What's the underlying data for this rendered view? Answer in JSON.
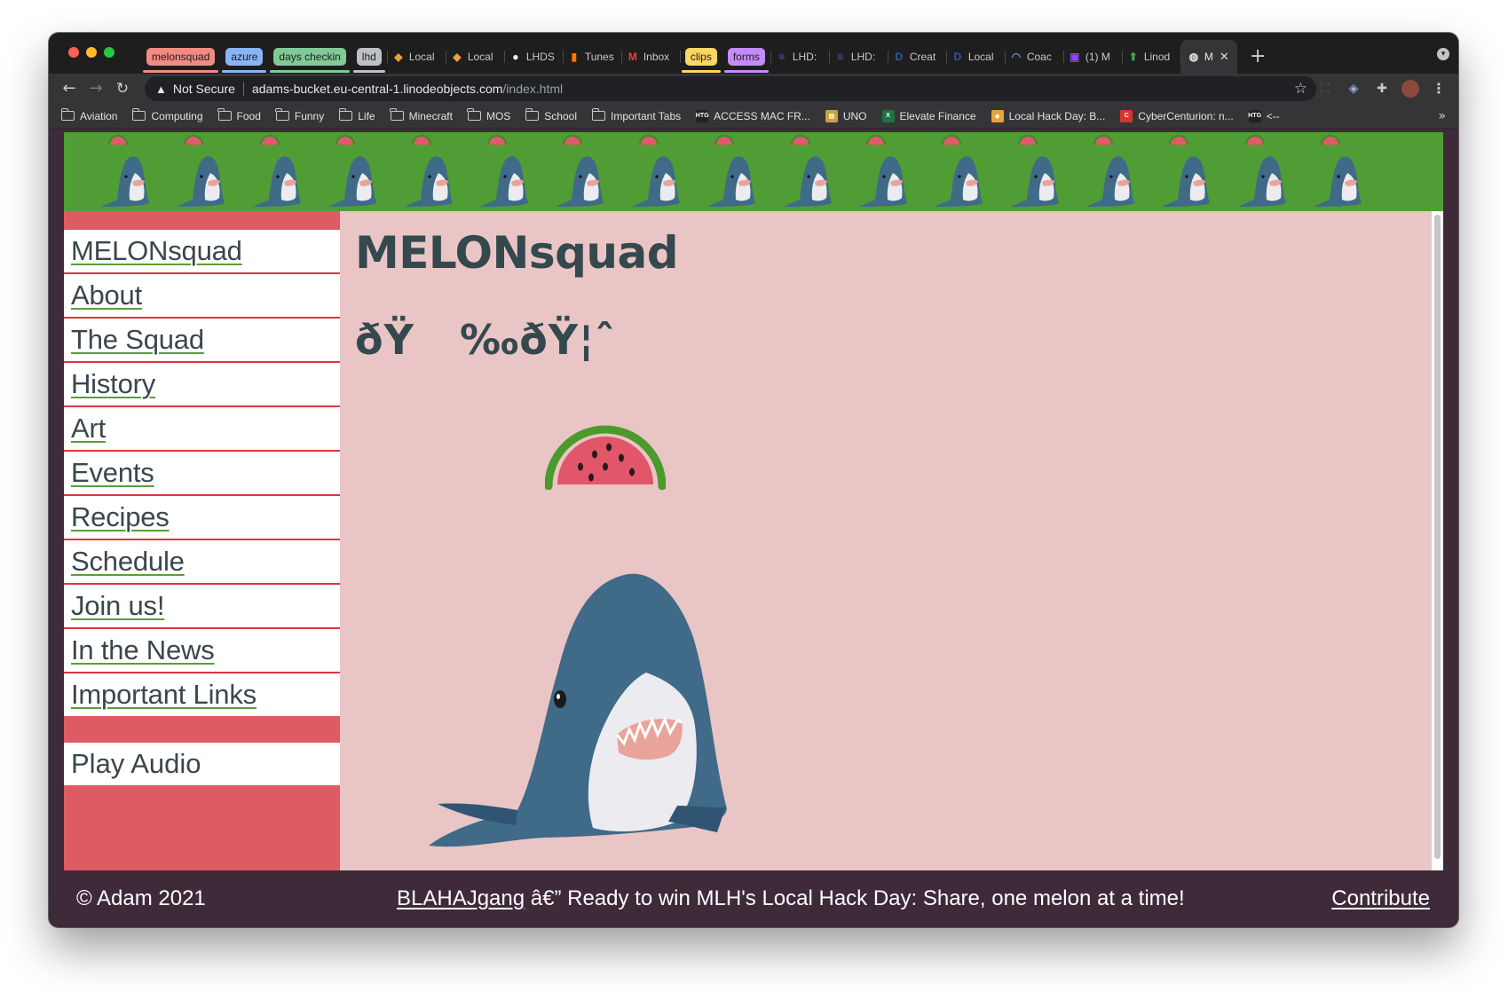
{
  "browser": {
    "tabs": [
      {
        "kind": "group",
        "label": "melonsquad",
        "color": "#f28b82"
      },
      {
        "kind": "group",
        "label": "azure",
        "color": "#8ab4f8"
      },
      {
        "kind": "group",
        "label": "days checkin",
        "color": "#81c995"
      },
      {
        "kind": "group",
        "label": "lhd",
        "color": "#bdc1c6"
      },
      {
        "kind": "tab",
        "title": "Local",
        "icon": "devpost-icon",
        "icon_color": "#e8a33a"
      },
      {
        "kind": "tab",
        "title": "Local",
        "icon": "devpost-icon",
        "icon_color": "#e8a33a"
      },
      {
        "kind": "tab",
        "title": "LHDS",
        "icon": "github-icon",
        "icon_color": "#ffffff"
      },
      {
        "kind": "tab",
        "title": "Tunes",
        "icon": "soundcloud-icon",
        "icon_color": "#ff7700"
      },
      {
        "kind": "tab",
        "title": "Inbox",
        "icon": "gmail-icon",
        "icon_color": "#ea4335"
      },
      {
        "kind": "group",
        "label": "clips",
        "color": "#fdd663"
      },
      {
        "kind": "group",
        "label": "forms",
        "color": "#c58af9"
      },
      {
        "kind": "tab",
        "title": "LHD:",
        "icon": "forms-icon",
        "icon_color": "#7248b9"
      },
      {
        "kind": "tab",
        "title": "LHD:",
        "icon": "forms-icon",
        "icon_color": "#7248b9"
      },
      {
        "kind": "tab",
        "title": "Creat",
        "icon": "d-icon",
        "icon_color": "#2e5aa8"
      },
      {
        "kind": "tab",
        "title": "Local",
        "icon": "d-icon",
        "icon_color": "#2e5aa8"
      },
      {
        "kind": "tab",
        "title": "Coac",
        "icon": "coach-icon",
        "icon_color": "#6a8fd0"
      },
      {
        "kind": "tab",
        "title": "(1) M",
        "icon": "twitch-icon",
        "icon_color": "#9146ff"
      },
      {
        "kind": "tab",
        "title": "Linod",
        "icon": "linode-icon",
        "icon_color": "#3aa655"
      },
      {
        "kind": "active",
        "title": "M",
        "icon": "globe-icon",
        "icon_color": "#e8e8e8"
      }
    ],
    "new_tab_glyph": "+",
    "close_glyph": "✕",
    "security_label": "Not Secure",
    "url_host": "adams-bucket.eu-central-1.linodeobjects.com",
    "url_path": "/index.html",
    "bookmarks": [
      {
        "label": "Aviation",
        "icon": "folder-icon"
      },
      {
        "label": "Computing",
        "icon": "folder-icon"
      },
      {
        "label": "Food",
        "icon": "folder-icon"
      },
      {
        "label": "Funny",
        "icon": "folder-icon"
      },
      {
        "label": "Life",
        "icon": "folder-icon"
      },
      {
        "label": "Minecraft",
        "icon": "folder-icon"
      },
      {
        "label": "MOS",
        "icon": "folder-icon"
      },
      {
        "label": "School",
        "icon": "folder-icon"
      },
      {
        "label": "Important Tabs",
        "icon": "folder-icon"
      },
      {
        "label": "ACCESS MAC FR...",
        "icon": "htg-icon",
        "icon_color": "#222222"
      },
      {
        "label": "UNO",
        "icon": "uno-icon",
        "icon_color": "#c8a040"
      },
      {
        "label": "Elevate Finance",
        "icon": "excel-icon",
        "icon_color": "#1e7145"
      },
      {
        "label": "Local Hack Day: B...",
        "icon": "devpost-icon",
        "icon_color": "#e8a33a"
      },
      {
        "label": "CyberCenturion: n...",
        "icon": "cybercenturion-icon",
        "icon_color": "#d8352b"
      },
      {
        "label": "<--",
        "icon": "htg-icon",
        "icon_color": "#222222"
      }
    ],
    "bookmarks_overflow": "»"
  },
  "page": {
    "nav": [
      "MELONsquad",
      "About",
      "The Squad",
      "History",
      "Art",
      "Events",
      "Recipes",
      "Schedule",
      "Join us!",
      "In the News",
      "Important Links"
    ],
    "play_audio": "Play Audio",
    "title": "MELONsquad",
    "mojibake_line": "ðŸ   ‰ðŸ¦ˆ",
    "footer": {
      "copyright": "© Adam 2021",
      "tagline_link": "BLAHAJgang",
      "tagline_rest": " â€” Ready to win MLH's Local Hack Day: Share, one melon at a time!",
      "contribute": "Contribute"
    },
    "colors": {
      "banner": "#4f9d34",
      "sidebar": "#de5b63",
      "content_bg": "#e9c5c5",
      "text": "#34484e",
      "footer_bg": "#3e2a38",
      "link_underline": "#5b9d3a"
    }
  }
}
